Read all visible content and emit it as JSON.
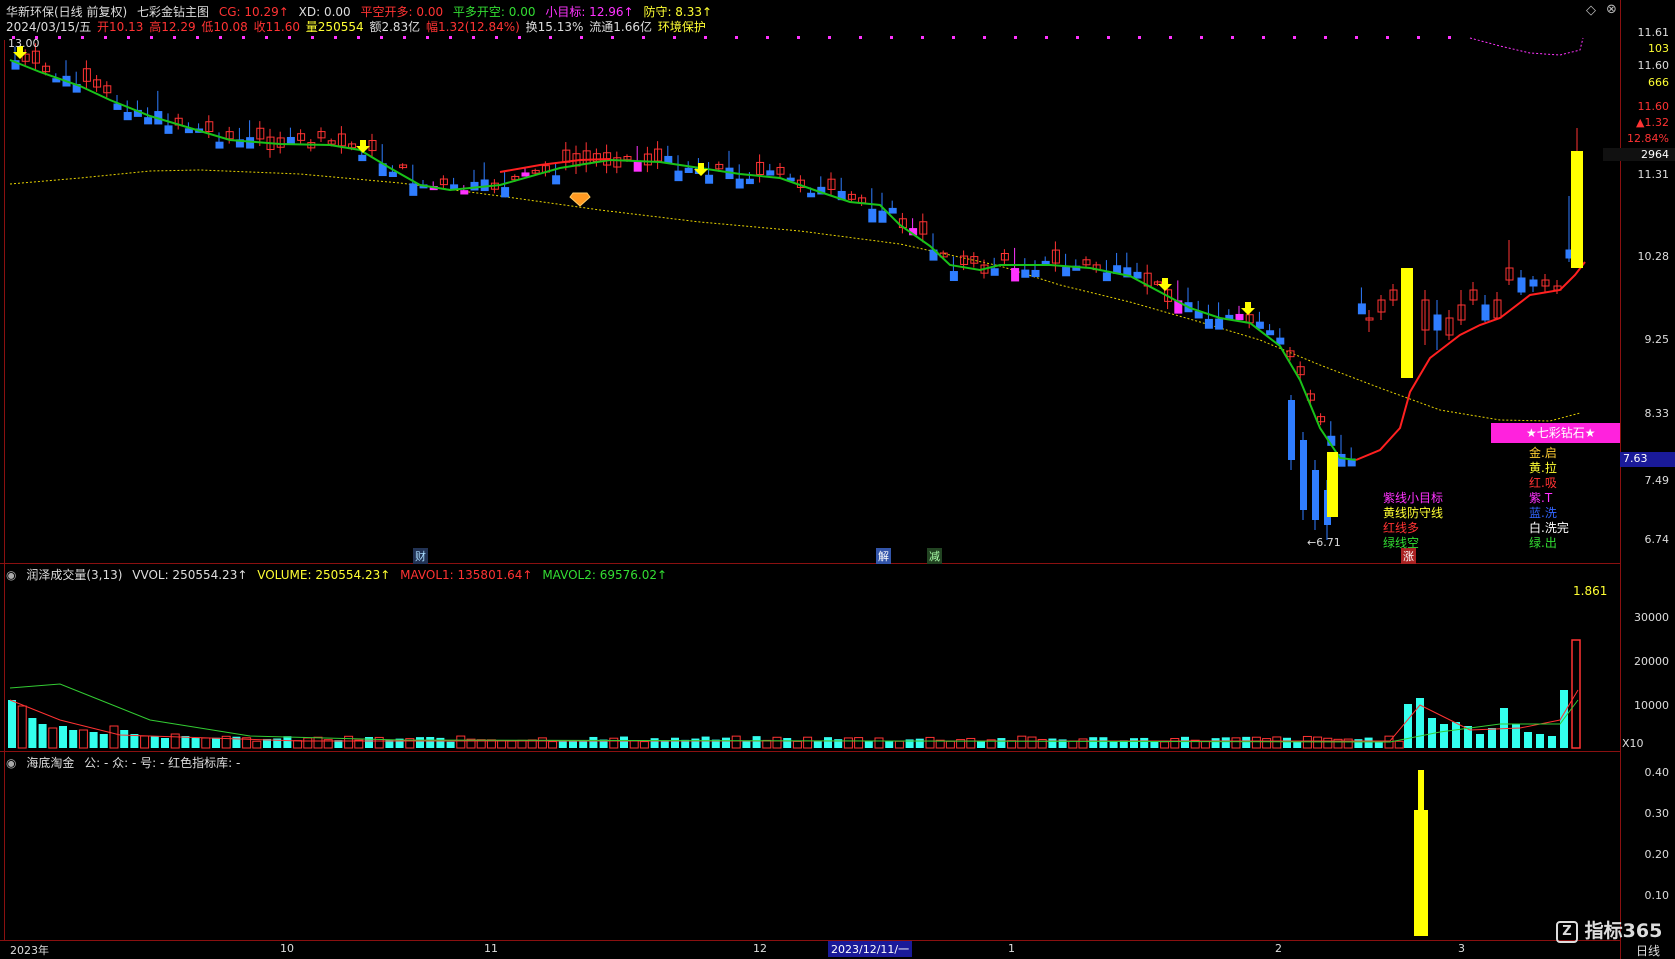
{
  "header": {
    "stock_name": "华新环保(日线 前复权)",
    "indicator_name": "七彩金钻主图",
    "cg": "CG: 10.29↑",
    "xd": "XD: 0.00",
    "pk_kd": "平空开多: 0.00",
    "pd_kk": "平多开空: 0.00",
    "target": "小目标: 12.96↑",
    "defense": "防守: 8.33↑"
  },
  "ohlc": {
    "date": "2024/03/15/五",
    "open": "开10.13",
    "high": "高12.29",
    "low": "低10.08",
    "close": "收11.60",
    "volume": "量250554",
    "amount": "额2.83亿",
    "change": "幅1.32(12.84%)",
    "turnover": "换15.13%",
    "float": "流通1.66亿",
    "sector": "环境保护"
  },
  "price_axis": {
    "labels": [
      "11.61",
      "103",
      "11.60",
      "666",
      "11.60",
      "▲1.32",
      "12.84%",
      "2964",
      "11.31",
      "10.28",
      "9.25",
      "8.33",
      "7.63",
      "7.49",
      "6.74"
    ]
  },
  "chart_text": {
    "max_label": "13.00",
    "min_label": "←6.71",
    "cai_badge": "财",
    "jie_badge": "解",
    "jian_badge": "减",
    "zhang_badge": "涨",
    "legend_left": [
      "紫线小目标",
      "黄线防守线",
      "红线多",
      "绿线空"
    ],
    "legend_right_title": "★七彩钻石★",
    "legend_right": [
      "金.启",
      "黄.拉",
      "红.吸",
      "紫.T",
      "蓝.洗",
      "白.洗完",
      "绿.出"
    ]
  },
  "volume_panel": {
    "title": "润泽成交量(3,13)",
    "vvol": "VVOL: 250554.23↑",
    "volume": "VOLUME: 250554.23↑",
    "mavol1": "MAVOL1: 135801.64↑",
    "mavol2": "MAVOL2: 69576.02↑",
    "ratio": "1.861",
    "axis": [
      "30000",
      "20000",
      "10000"
    ],
    "unit": "X10"
  },
  "indicator_panel": {
    "title": "海底淘金",
    "params": "公: -  众: -  号: -  红色指标库: -",
    "axis": [
      "0.40",
      "0.30",
      "0.20",
      "0.10"
    ]
  },
  "time_axis": {
    "labels": [
      "2023年",
      "10",
      "11",
      "12",
      "1",
      "2",
      "3"
    ],
    "cursor_date": "2023/12/11/一",
    "period": "日线"
  },
  "watermark": "指标365",
  "colors": {
    "up": "#ff3333",
    "down": "#2f7dff",
    "green_line": "#19c219",
    "red_line": "#ff2020",
    "yellow": "#ffff00",
    "magenta": "#ff33ff",
    "cyan": "#33ffee"
  }
}
